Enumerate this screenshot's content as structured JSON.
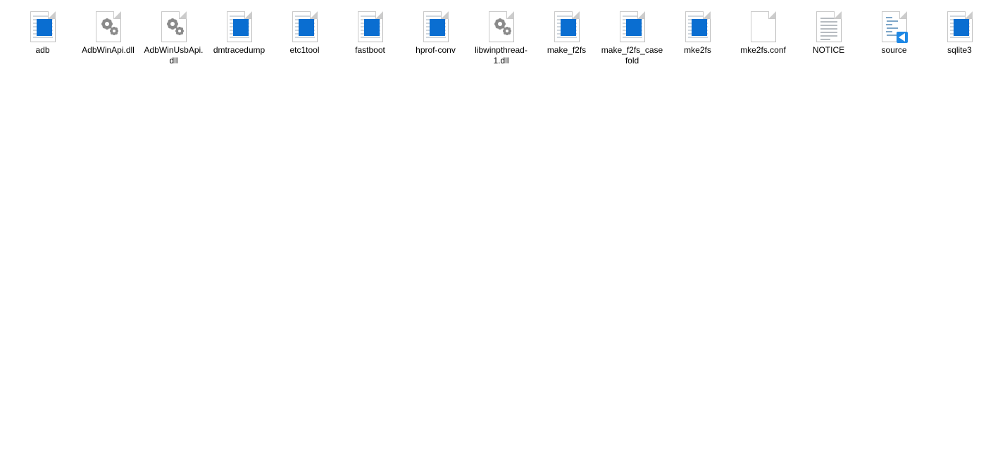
{
  "files": [
    {
      "name": "adb",
      "icon": "app"
    },
    {
      "name": "AdbWinApi.dll",
      "icon": "dll"
    },
    {
      "name": "AdbWinUsbApi.dll",
      "icon": "dll"
    },
    {
      "name": "dmtracedump",
      "icon": "app"
    },
    {
      "name": "etc1tool",
      "icon": "app"
    },
    {
      "name": "fastboot",
      "icon": "app"
    },
    {
      "name": "hprof-conv",
      "icon": "app"
    },
    {
      "name": "libwinpthread-1.dll",
      "icon": "dll"
    },
    {
      "name": "make_f2fs",
      "icon": "app"
    },
    {
      "name": "make_f2fs_casefold",
      "icon": "app"
    },
    {
      "name": "mke2fs",
      "icon": "app"
    },
    {
      "name": "mke2fs.conf",
      "icon": "blank"
    },
    {
      "name": "NOTICE",
      "icon": "text"
    },
    {
      "name": "source",
      "icon": "code"
    },
    {
      "name": "sqlite3",
      "icon": "app"
    }
  ]
}
